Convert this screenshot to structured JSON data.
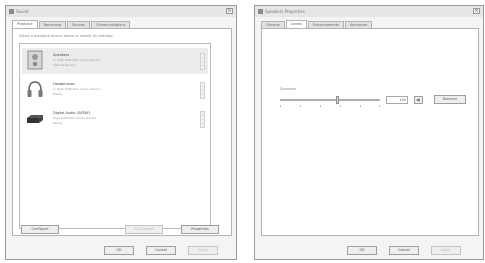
{
  "left_window": {
    "title": "Sound",
    "tabs": [
      {
        "label": "Playback",
        "active": true
      },
      {
        "label": "Recording",
        "active": false
      },
      {
        "label": "Sounds",
        "active": false
      },
      {
        "label": "Communications",
        "active": false
      }
    ],
    "instruction": "Select a playback device below to modify its settings:",
    "devices": [
      {
        "name": "Speakers",
        "line1": "2- High Definition Audio Device",
        "line2": "Default Device",
        "icon": "speaker-icon",
        "selected": true
      },
      {
        "name": "Headphones",
        "line1": "2- High Definition Audio Device",
        "line2": "Ready",
        "icon": "headphones-icon",
        "selected": false
      },
      {
        "name": "Digital Audio (S/PDIF)",
        "line1": "High Definition Audio Device",
        "line2": "Ready",
        "icon": "digital-output-icon",
        "selected": false
      }
    ],
    "configure_label": "Configure",
    "set_default_label": "Set Default",
    "properties_label": "Properties",
    "ok_label": "OK",
    "cancel_label": "Cancel",
    "apply_label": "Apply"
  },
  "right_window": {
    "title": "Speakers Properties",
    "tabs": [
      {
        "label": "General",
        "active": false
      },
      {
        "label": "Levels",
        "active": true
      },
      {
        "label": "Enhancements",
        "active": false
      },
      {
        "label": "Advanced",
        "active": false
      }
    ],
    "control_label": "Speakers",
    "volume_value": "100",
    "volume_fraction": 0.58,
    "balance_label": "Balance",
    "ok_label": "OK",
    "cancel_label": "Cancel",
    "apply_label": "Apply"
  }
}
